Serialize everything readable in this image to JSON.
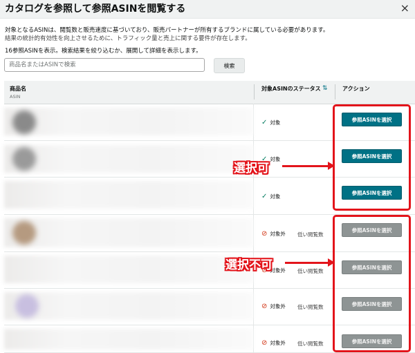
{
  "dialog": {
    "title": "カタログを参照して参照ASINを閲覧する",
    "close_label": "×",
    "description_line1": "対象となるASINは、閲覧数と販売速度に基づいており、販売パートナーが所有するブランドに属している必要があります。",
    "description_line2": "結果の統計的有効性を向上させるために、トラフィック量と売上に関する要件が存在します。",
    "results_count": "16参照ASINを表示。検索結果を絞り込むか、展開して詳細を表示します。"
  },
  "search": {
    "placeholder": "商品名またはASINで検索",
    "button_label": "検索"
  },
  "table": {
    "col_product": "商品名",
    "col_product_sub": "ASIN",
    "col_status": "対象ASINのステータス",
    "col_action": "アクション",
    "rows": [
      {
        "status": "対象",
        "eligible": true,
        "button": "参照ASINを選択",
        "low_views": ""
      },
      {
        "status": "対象",
        "eligible": true,
        "button": "参照ASINを選択",
        "low_views": ""
      },
      {
        "status": "対象",
        "eligible": true,
        "button": "参照ASINを選択",
        "low_views": ""
      },
      {
        "status": "対象外",
        "eligible": false,
        "button": "参照ASINを選択",
        "low_views": "低い閲覧数"
      },
      {
        "status": "対象外",
        "eligible": false,
        "button": "参照ASINを選択",
        "low_views": "低い閲覧数"
      },
      {
        "status": "対象外",
        "eligible": false,
        "button": "参照ASINを選択",
        "low_views": "低い閲覧数"
      },
      {
        "status": "対象外",
        "eligible": false,
        "button": "参照ASINを選択",
        "low_views": "低い閲覧数"
      }
    ]
  },
  "annotations": {
    "selectable": "選択可",
    "not_selectable": "選択不可",
    "color": "#e3141b"
  },
  "icons": {
    "check": "✓",
    "prohibited": "⊘",
    "sort": "⇅"
  }
}
